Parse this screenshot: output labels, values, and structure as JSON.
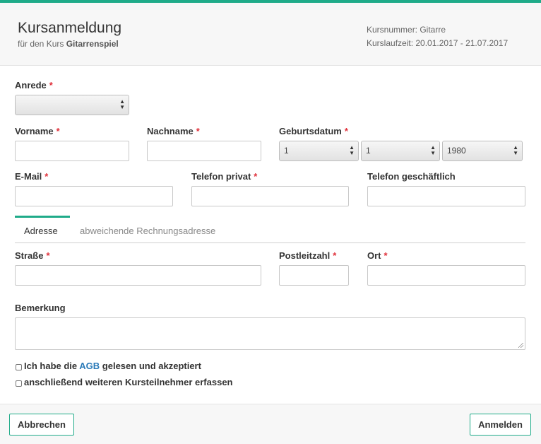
{
  "header": {
    "title": "Kursanmeldung",
    "subtitle_prefix": "für den Kurs",
    "course_name": "Gitarrenspiel",
    "course_number": "Kursnummer: Gitarre",
    "course_period": "Kurslaufzeit: 20.01.2017 - 21.07.2017"
  },
  "form": {
    "required_mark": "*",
    "salutation": {
      "label": "Anrede",
      "value": ""
    },
    "first_name": {
      "label": "Vorname",
      "value": ""
    },
    "last_name": {
      "label": "Nachname",
      "value": ""
    },
    "birthdate": {
      "label": "Geburtsdatum",
      "day": "1",
      "month": "1",
      "year": "1980"
    },
    "email": {
      "label": "E-Mail",
      "value": ""
    },
    "phone_private": {
      "label": "Telefon privat",
      "value": ""
    },
    "phone_business": {
      "label": "Telefon geschäftlich",
      "value": ""
    },
    "street": {
      "label": "Straße",
      "value": ""
    },
    "postal_code": {
      "label": "Postleitzahl",
      "value": ""
    },
    "city": {
      "label": "Ort",
      "value": ""
    },
    "remark": {
      "label": "Bemerkung",
      "value": ""
    }
  },
  "tabs": [
    {
      "label": "Adresse",
      "active": true
    },
    {
      "label": "abweichende Rechnungsadresse",
      "active": false
    }
  ],
  "checkboxes": {
    "agb_prefix": "Ich habe die",
    "agb_link": "AGB",
    "agb_suffix": "gelesen und akzeptiert",
    "agb_checked": false,
    "more_participants": "anschließend weiteren Kursteilnehmer erfassen",
    "more_checked": false
  },
  "footer": {
    "cancel_label": "Abbrechen",
    "submit_label": "Anmelden"
  },
  "colors": {
    "accent": "#1fab89",
    "required": "#e0303a",
    "link": "#2a7ab8"
  }
}
